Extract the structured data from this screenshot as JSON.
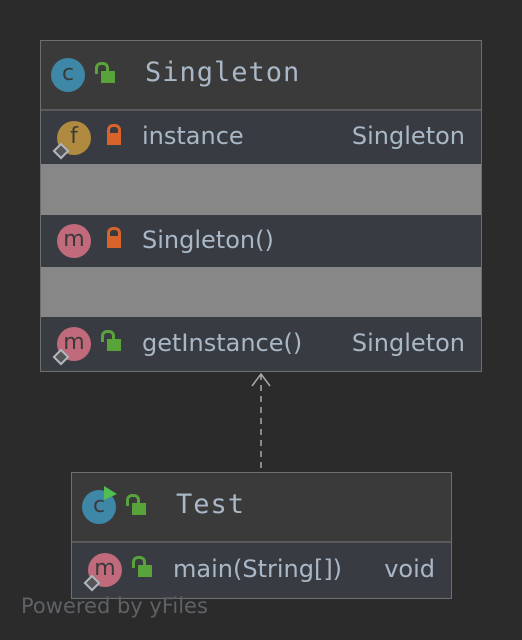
{
  "classes": [
    {
      "name": "Singleton",
      "icon": "class-icon",
      "fields": [
        {
          "name": "instance",
          "type": "Singleton",
          "visibility": "private",
          "static": true
        }
      ],
      "constructors": [
        {
          "name": "Singleton()",
          "visibility": "private"
        }
      ],
      "methods": [
        {
          "name": "getInstance()",
          "type": "Singleton",
          "visibility": "public",
          "static": true
        }
      ]
    },
    {
      "name": "Test",
      "icon": "runnable-class-icon",
      "methods": [
        {
          "name": "main(String[])",
          "type": "void",
          "visibility": "public",
          "static": true
        }
      ]
    }
  ],
  "badges": {
    "class": "c",
    "field": "f",
    "method": "m"
  },
  "relation": "dependency Test -> Singleton",
  "footer": "Powered by yFiles"
}
